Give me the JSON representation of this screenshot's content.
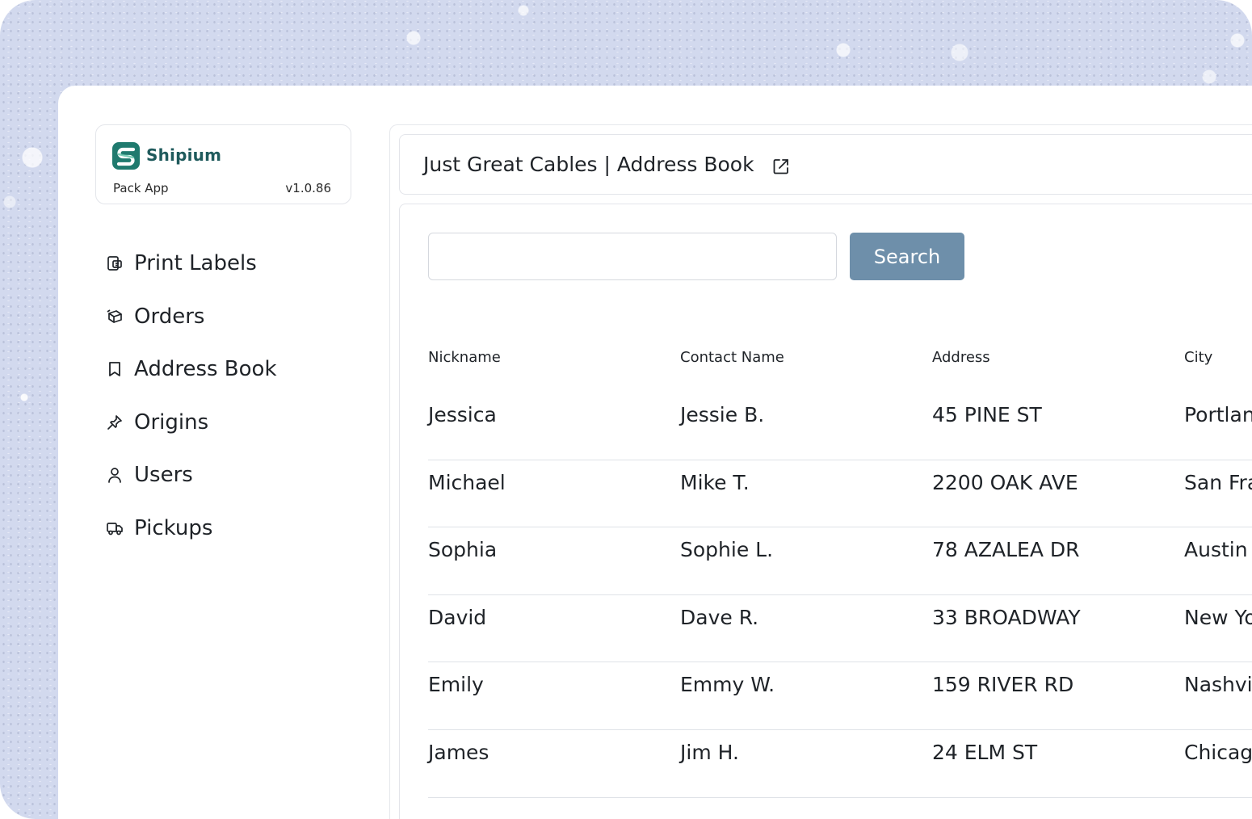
{
  "brand": {
    "name": "Shipium",
    "subtitle": "Pack App",
    "version": "v1.0.86",
    "color": "#1f7a6e"
  },
  "sidebar": {
    "items": [
      {
        "label": "Print Labels",
        "icon": "print-labels-icon"
      },
      {
        "label": "Orders",
        "icon": "box-icon"
      },
      {
        "label": "Address Book",
        "icon": "bookmark-icon"
      },
      {
        "label": "Origins",
        "icon": "pin-icon"
      },
      {
        "label": "Users",
        "icon": "user-icon"
      },
      {
        "label": "Pickups",
        "icon": "truck-icon"
      }
    ]
  },
  "header": {
    "title": "Just Great Cables | Address Book",
    "icon": "external-link-icon"
  },
  "search": {
    "value": "",
    "placeholder": "",
    "button_label": "Search",
    "button_color": "#6e8faa"
  },
  "table": {
    "columns": [
      "Nickname",
      "Contact Name",
      "Address",
      "City"
    ],
    "rows": [
      [
        "Jessica",
        "Jessie B.",
        "45 PINE ST",
        "Portland"
      ],
      [
        "Michael",
        "Mike T.",
        "2200 OAK AVE",
        "San Francisco"
      ],
      [
        "Sophia",
        "Sophie L.",
        "78 AZALEA DR",
        "Austin"
      ],
      [
        "David",
        "Dave R.",
        "33 BROADWAY",
        "New York"
      ],
      [
        "Emily",
        "Emmy W.",
        "159 RIVER RD",
        "Nashville"
      ],
      [
        "James",
        "Jim H.",
        "24 ELM ST",
        "Chicago"
      ]
    ]
  }
}
